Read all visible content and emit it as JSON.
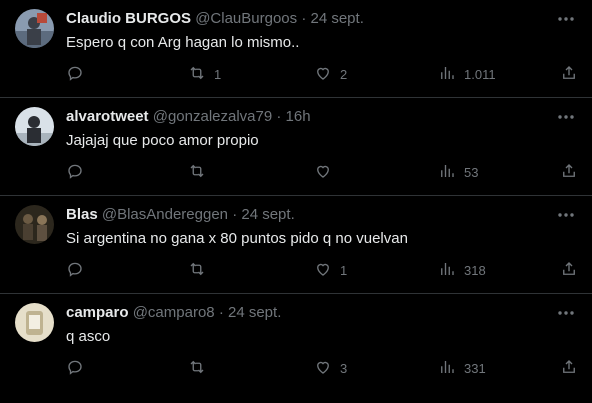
{
  "tweets": [
    {
      "name": "Claudio BURGOS",
      "handle": "@ClauBurgoos",
      "dot": "·",
      "time": "24 sept.",
      "text": "Espero q con Arg hagan lo mismo..",
      "replies": "",
      "retweets": "1",
      "likes": "2",
      "views": "1.011",
      "avatar_color": "#6b7f9a"
    },
    {
      "name": "alvarotweet",
      "handle": "@gonzalezalva79",
      "dot": "·",
      "time": "16h",
      "text": "Jajajaj que poco amor propio",
      "replies": "",
      "retweets": "",
      "likes": "",
      "views": "53",
      "avatar_color": "#c9d3dc"
    },
    {
      "name": "Blas",
      "handle": "@BlasAndereggen",
      "dot": "·",
      "time": "24 sept.",
      "text": "Si argentina no gana x 80 puntos pido q no vuelvan",
      "replies": "",
      "retweets": "",
      "likes": "1",
      "views": "318",
      "avatar_color": "#3b3426"
    },
    {
      "name": "camparo",
      "handle": "@camparo8",
      "dot": "·",
      "time": "24 sept.",
      "text": "q asco",
      "replies": "",
      "retweets": "",
      "likes": "3",
      "views": "331",
      "avatar_color": "#d8cfb6"
    }
  ],
  "icons": {
    "more": "more-icon",
    "reply": "reply-icon",
    "retweet": "retweet-icon",
    "like": "like-icon",
    "views": "views-icon",
    "share": "share-icon"
  }
}
